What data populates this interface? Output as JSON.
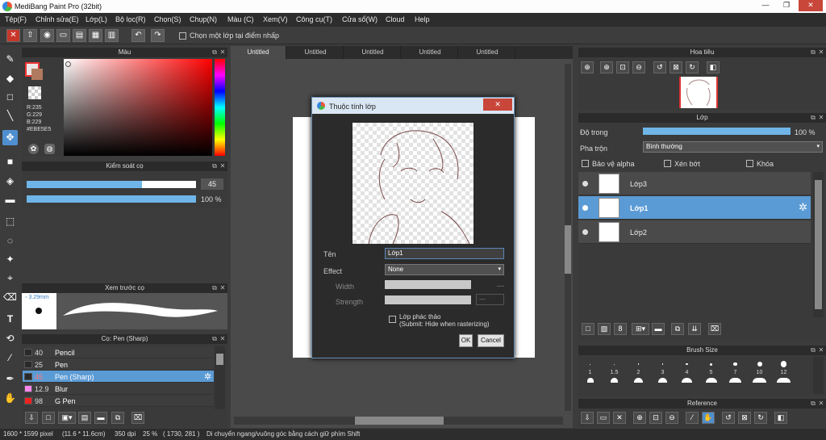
{
  "window": {
    "title": "MediBang Paint Pro (32bit)",
    "minimize": "—",
    "restore": "❐",
    "close": "✕"
  },
  "menu": [
    "Tệp(F)",
    "Chỉnh sửa(E)",
    "Lớp(L)",
    "Bộ lọc(R)",
    "Chọn(S)",
    "Chụp(N)",
    "Màu (C)",
    "Xem(V)",
    "Công cụ(T)",
    "Cửa sổ(W)",
    "Cloud",
    "Help"
  ],
  "toolbar": {
    "select_layer_label": "Chọn một lớp tại điểm nhấp"
  },
  "color_panel": {
    "title": "Màu",
    "r": "R:235",
    "g": "G:229",
    "b": "B:229",
    "hex": "#EBE5E5",
    "fg_color": "#ebe5e5"
  },
  "brush_control": {
    "title": "Kiểm soát cọ",
    "size_value": "45",
    "size_fraction": 0.68,
    "opacity_value": "100 %",
    "opacity_fraction": 1.0
  },
  "brush_preview": {
    "title": "Xem trước cọ",
    "size_label": "3.29mm"
  },
  "brush_list": {
    "title": "Cọ: Pen (Sharp)",
    "items": [
      {
        "size": "40",
        "name": "Pencil",
        "color": "#2a2a2a"
      },
      {
        "size": "25",
        "name": "Pen",
        "color": "#2a2a2a"
      },
      {
        "size": "45",
        "name": "Pen (Sharp)",
        "color": "#2a2a2a",
        "selected": true
      },
      {
        "size": "12.9",
        "name": "Blur",
        "color": "#ff88ee"
      },
      {
        "size": "98",
        "name": "G Pen",
        "color": "#ee2222"
      }
    ]
  },
  "tabs": [
    "Untitled",
    "Untitled",
    "Untitled",
    "Untitled",
    "Untitled"
  ],
  "navigator": {
    "title": "Hoa tiêu"
  },
  "layer_panel": {
    "title": "Lớp",
    "opacity_label": "Độ trong",
    "opacity_value": "100 %",
    "blend_label": "Pha trộn",
    "blend_value": "Bình thường",
    "protect_alpha": "Bảo vệ alpha",
    "clipping": "Xén bớt",
    "lock": "Khóa",
    "layers": [
      {
        "name": "Lớp3",
        "selected": false
      },
      {
        "name": "Lớp1",
        "selected": true
      },
      {
        "name": "Lớp2",
        "selected": false
      }
    ]
  },
  "brush_size": {
    "title": "Brush Size",
    "sizes": [
      "1",
      "1.5",
      "2",
      "3",
      "4",
      "5",
      "7",
      "10",
      "12"
    ]
  },
  "reference": {
    "title": "Reference"
  },
  "dialog": {
    "title": "Thuộc tính lớp",
    "name_label": "Tên",
    "name_value": "Lớp1",
    "effect_label": "Effect",
    "effect_value": "None",
    "width_label": "Width",
    "width_dash": "---",
    "strength_label": "Strength",
    "strength_dash": "---",
    "draft_label": "Lớp phác thảo",
    "draft_sub": "(Submit: Hide when rasterizing)",
    "ok": "OK",
    "cancel": "Cancel"
  },
  "status": {
    "size": "1600 * 1599 pixel",
    "cm": "(11.6 * 11.6cm)",
    "dpi": "350 dpi",
    "zoom": "25 %",
    "coords": "( 1730, 281 )",
    "hint": "Di chuyển ngang/vuông góc bằng cách giữ phím Shift"
  }
}
